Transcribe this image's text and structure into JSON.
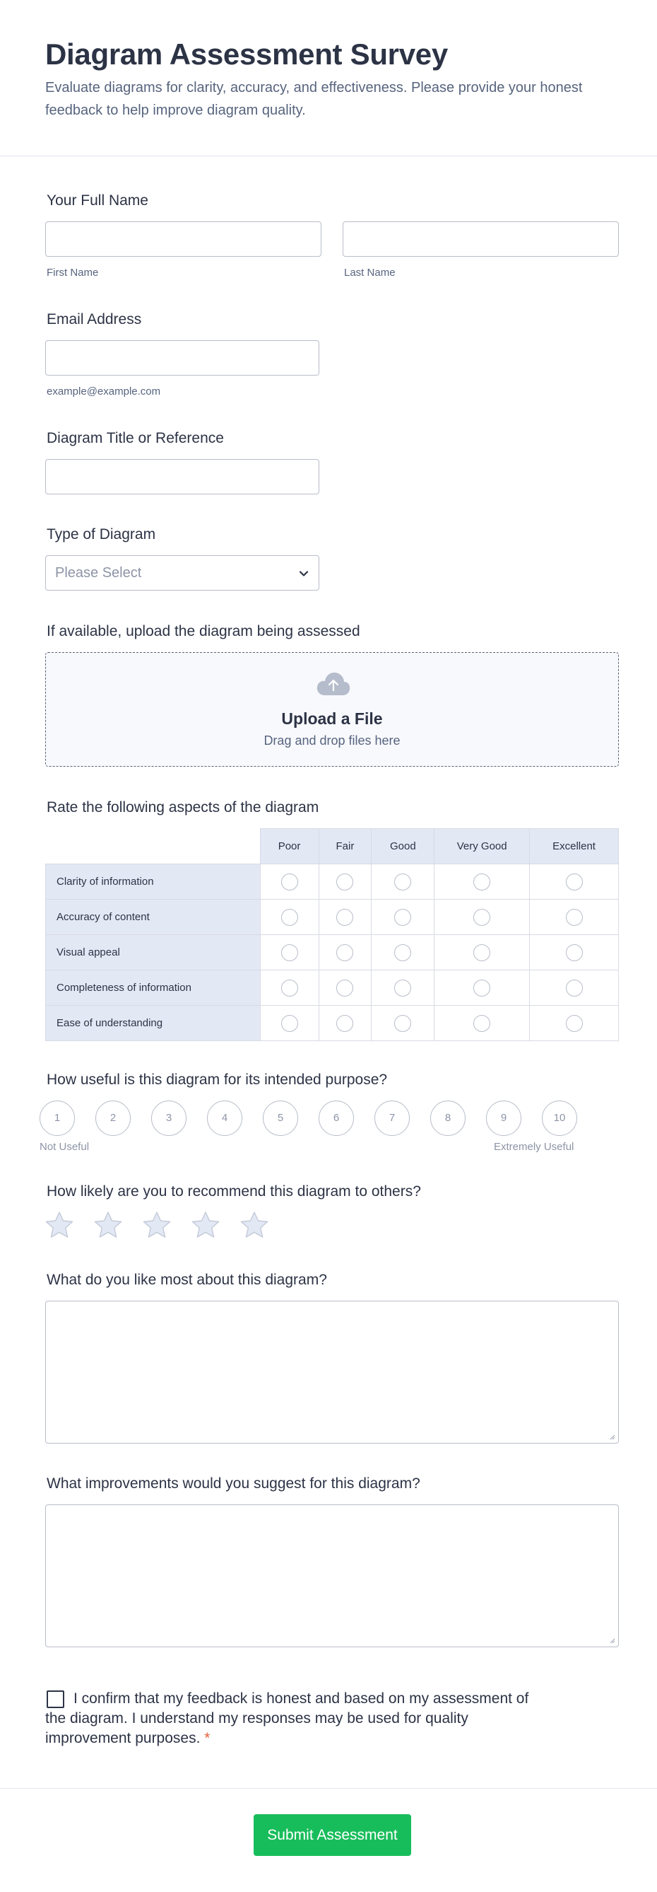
{
  "header": {
    "title": "Diagram Assessment Survey",
    "description": "Evaluate diagrams for clarity, accuracy, and effectiveness. Please provide your honest feedback to help improve diagram quality."
  },
  "full_name": {
    "label": "Your Full Name",
    "first_sublabel": "First Name",
    "last_sublabel": "Last Name",
    "first_value": "",
    "last_value": ""
  },
  "email": {
    "label": "Email Address",
    "sublabel": "example@example.com",
    "value": ""
  },
  "diagram_title": {
    "label": "Diagram Title or Reference",
    "value": ""
  },
  "diagram_type": {
    "label": "Type of Diagram",
    "selected": "Please Select"
  },
  "upload": {
    "label": "If available, upload the diagram being assessed",
    "title": "Upload a File",
    "subtitle": "Drag and drop files here",
    "icon": "cloud-upload-icon"
  },
  "matrix": {
    "label": "Rate the following aspects of the diagram",
    "columns": [
      "Poor",
      "Fair",
      "Good",
      "Very Good",
      "Excellent"
    ],
    "rows": [
      "Clarity of information",
      "Accuracy of content",
      "Visual appeal",
      "Completeness of information",
      "Ease of understanding"
    ]
  },
  "usefulness": {
    "label": "How useful is this diagram for its intended purpose?",
    "options": [
      "1",
      "2",
      "3",
      "4",
      "5",
      "6",
      "7",
      "8",
      "9",
      "10"
    ],
    "min_caption": "Not Useful",
    "max_caption": "Extremely Useful"
  },
  "recommend": {
    "label": "How likely are you to recommend this diagram to others?",
    "stars": 5,
    "rating": 0
  },
  "likes": {
    "label": "What do you like most about this diagram?",
    "value": ""
  },
  "improvements": {
    "label": "What improvements would you suggest for this diagram?",
    "value": ""
  },
  "consent": {
    "text": "I confirm that my feedback is honest and based on my assessment of the diagram. I understand my responses may be used for quality improvement purposes.",
    "required_mark": "*",
    "checked": false
  },
  "submit": {
    "label": "Submit Assessment"
  },
  "colors": {
    "accent": "#18bd5b",
    "text": "#2c3345",
    "muted": "#57647e",
    "matrix_header": "#e3e8f5",
    "required": "#e8603c"
  }
}
